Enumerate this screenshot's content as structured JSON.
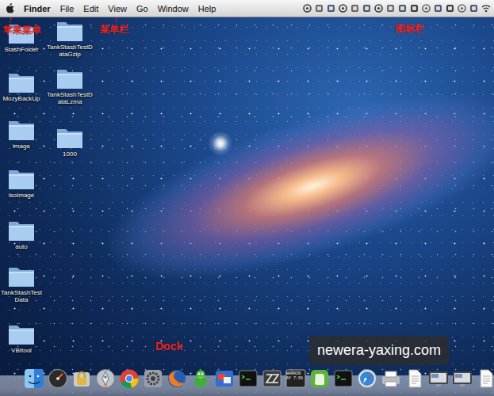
{
  "menu_bar": {
    "menus": [
      "Finder",
      "File",
      "Edit",
      "View",
      "Go",
      "Window",
      "Help"
    ]
  },
  "annotations": [
    {
      "text": "苹果菜单",
      "arrow": "↑"
    },
    {
      "text": "菜单栏",
      "arrow": "↑"
    },
    {
      "text": "图标栏"
    },
    {
      "text": "Dock"
    }
  ],
  "desktop_items": [
    {
      "label": "StashFolder"
    },
    {
      "label": "MozyBackUp"
    },
    {
      "label": "image"
    },
    {
      "label": "isoImage"
    },
    {
      "label": "auto"
    },
    {
      "label": "TankStashTestData"
    },
    {
      "label": "VBItool"
    },
    {
      "label": "TankStashTestDataGzip"
    },
    {
      "label": "TankStashTestDataLzma"
    },
    {
      "label": "1000"
    }
  ],
  "dock": {
    "items": [
      {
        "kind": "finder"
      },
      {
        "kind": "dashboard"
      },
      {
        "kind": "keychain"
      },
      {
        "kind": "launchpad"
      },
      {
        "kind": "chrome"
      },
      {
        "kind": "sysprefs"
      },
      {
        "kind": "firefox"
      },
      {
        "kind": "adium"
      },
      {
        "kind": "remote"
      },
      {
        "kind": "terminal"
      },
      {
        "kind": "archiver"
      },
      {
        "kind": "console",
        "lines": [
          "WARNIN",
          "AY 7:56"
        ]
      },
      {
        "kind": "evernote"
      },
      {
        "kind": "terminal"
      },
      {
        "kind": "safari"
      },
      {
        "kind": "printer"
      },
      {
        "kind": "document"
      },
      {
        "kind": "screen"
      },
      {
        "kind": "screen"
      },
      {
        "kind": "document"
      }
    ]
  },
  "watermark": "newera-yaxing.com"
}
